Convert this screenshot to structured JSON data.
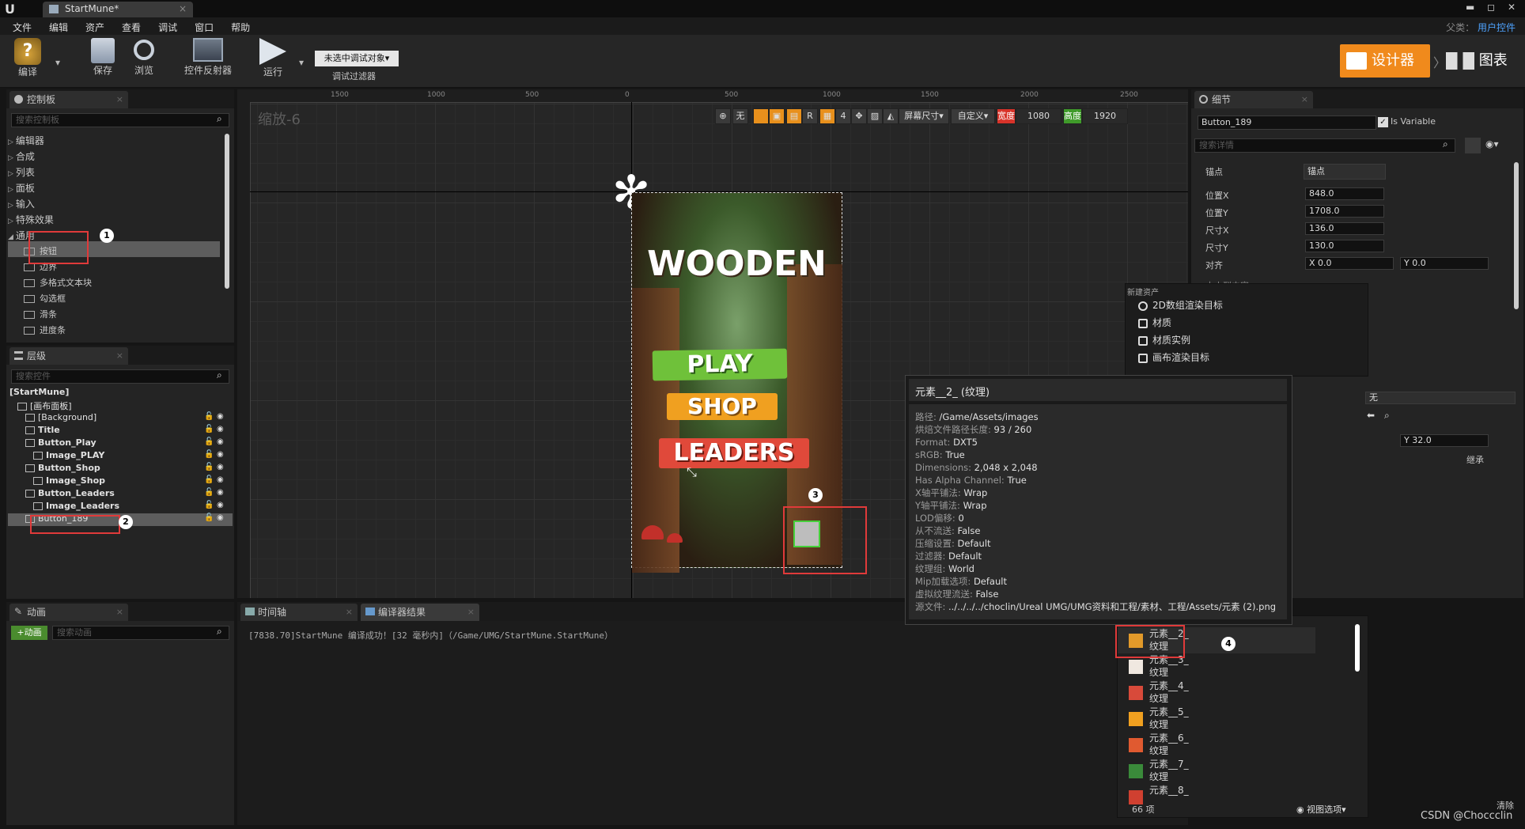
{
  "window": {
    "tab_title": "StartMune*",
    "top_right_parent": "父类：",
    "top_right_class": "用户控件"
  },
  "menu": [
    "文件",
    "编辑",
    "资产",
    "查看",
    "调试",
    "窗口",
    "帮助"
  ],
  "toolbar": {
    "compile": "编译",
    "save": "保存",
    "browse": "浏览",
    "widget_reflector": "控件反射器",
    "run": "运行",
    "debug_object": "未选中调试对象▾",
    "debug_filter": "调试过滤器",
    "designer": "设计器",
    "graph": "图表"
  },
  "palette": {
    "title": "控制板",
    "search_placeholder": "搜索控制板",
    "categories": [
      "编辑器",
      "合成",
      "列表",
      "面板",
      "输入",
      "特殊效果",
      "通用"
    ],
    "items": [
      "按钮",
      "边界",
      "多格式文本块",
      "勾选框",
      "滑条",
      "进度条"
    ]
  },
  "hierarchy": {
    "title": "层级",
    "search_placeholder": "搜索控件",
    "items": [
      "[StartMune]",
      "[画布面板]",
      "[Background]",
      "Title",
      "Button_Play",
      "Image_PLAY",
      "Button_Shop",
      "Image_Shop",
      "Button_Leaders",
      "Image_Leaders",
      "Button_189"
    ]
  },
  "animation": {
    "title": "动画",
    "add": "+动画",
    "search_placeholder": "搜索动画"
  },
  "bottom_tabs": {
    "timeline": "时间轴",
    "compiler": "编译器结果"
  },
  "compiler_log": "[7838.70]StartMune 编译成功！[32 毫秒内]（/Game/UMG/StartMune.StartMune）",
  "viewport": {
    "zoom": "缩放-6",
    "ruler_labels": [
      "1500",
      "1000",
      "500",
      "0",
      "500",
      "1000",
      "1500",
      "2000",
      "2500"
    ],
    "buttons": {
      "none": "无",
      "r": "R",
      "four": "4",
      "screen_size": "屏幕尺寸▾",
      "custom": "自定义▾",
      "width_label": "宽度",
      "width": "1080",
      "height_label": "高度",
      "height": "1920"
    }
  },
  "game_ui": {
    "title": "WOODEN",
    "play": "PLAY",
    "shop": "SHOP",
    "leaders": "LEADERS"
  },
  "details": {
    "title": "细节",
    "name_value": "Button_189",
    "is_variable": "Is Variable",
    "search_placeholder": "搜索详情",
    "anchor_label": "锚点",
    "anchor_value": "锚点",
    "pos_x_label": "位置X",
    "pos_x": "848.0",
    "pos_y_label": "位置Y",
    "pos_y": "1708.0",
    "size_x_label": "尺寸X",
    "size_x": "136.0",
    "size_y_label": "尺寸Y",
    "size_y": "130.0",
    "align_label": "对齐",
    "align_x": "X  0.0",
    "align_y": "Y  0.0",
    "size_to_content": "大小到内容",
    "none_value": "无",
    "y32": "Y  32.0",
    "inherit": "继承"
  },
  "new_asset_menu": {
    "header": "新建资产",
    "items": [
      "2D数组渲染目标",
      "材质",
      "材质实例",
      "画布渲染目标"
    ]
  },
  "tooltip": {
    "title": "元素__2_ (纹理)",
    "lines": [
      {
        "k": "路径:",
        "v": "/Game/Assets/images"
      },
      {
        "k": "烘焙文件路径长度:",
        "v": "93 / 260"
      },
      {
        "k": "Format:",
        "v": "DXT5"
      },
      {
        "k": "sRGB:",
        "v": "True"
      },
      {
        "k": "Dimensions:",
        "v": "2,048 x 2,048"
      },
      {
        "k": "Has Alpha Channel:",
        "v": "True"
      },
      {
        "k": "X轴平铺法:",
        "v": "Wrap"
      },
      {
        "k": "Y轴平铺法:",
        "v": "Wrap"
      },
      {
        "k": "LOD偏移:",
        "v": "0"
      },
      {
        "k": "从不流送:",
        "v": "False"
      },
      {
        "k": "压缩设置:",
        "v": "Default"
      },
      {
        "k": "过滤器:",
        "v": "Default"
      },
      {
        "k": "纹理组:",
        "v": "World"
      },
      {
        "k": "Mip加载选项:",
        "v": "Default"
      },
      {
        "k": "虚拟纹理流送:",
        "v": "False"
      },
      {
        "k": "源文件:",
        "v": "../../../../choclin/Ureal UMG/UMG资料和工程/素材、工程/Assets/元素 (2).png"
      }
    ]
  },
  "asset_list": {
    "items": [
      {
        "name": "元素__2_",
        "type": "纹理"
      },
      {
        "name": "元素__3_",
        "type": "纹理"
      },
      {
        "name": "元素__4_",
        "type": "纹理"
      },
      {
        "name": "元素__5_",
        "type": "纹理"
      },
      {
        "name": "元素__6_",
        "type": "纹理"
      },
      {
        "name": "元素__7_",
        "type": "纹理"
      },
      {
        "name": "元素__8_",
        "type": ""
      }
    ],
    "count": "66 项",
    "view_options": "视图选项▾"
  },
  "markers": [
    "1",
    "2",
    "3",
    "4"
  ],
  "watermark": "CSDN @Choccclin",
  "clear": "清除"
}
